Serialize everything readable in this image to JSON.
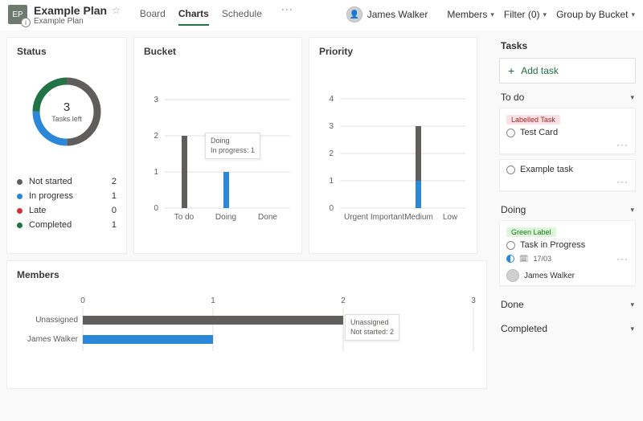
{
  "header": {
    "ep": "EP",
    "title": "Example Plan",
    "subtitle": "Example Plan",
    "star": "☆",
    "tabs": {
      "board": "Board",
      "charts": "Charts",
      "schedule": "Schedule",
      "more": "···"
    },
    "user": "James Walker",
    "actions": {
      "members": "Members",
      "filter": "Filter (0)",
      "group": "Group by Bucket"
    }
  },
  "cards": {
    "status": {
      "title": "Status",
      "center_value": "3",
      "center_label": "Tasks left",
      "legend": [
        {
          "label": "Not started",
          "value": "2",
          "color": "#605e5c"
        },
        {
          "label": "In progress",
          "value": "1",
          "color": "#2b88d8"
        },
        {
          "label": "Late",
          "value": "0",
          "color": "#d13438"
        },
        {
          "label": "Completed",
          "value": "1",
          "color": "#217346"
        }
      ]
    },
    "bucket": {
      "title": "Bucket",
      "tooltip_line1": "Doing",
      "tooltip_line2": "In progress: 1"
    },
    "priority": {
      "title": "Priority"
    },
    "members": {
      "title": "Members",
      "tooltip_line1": "Unassigned",
      "tooltip_line2": "Not started: 2"
    }
  },
  "tasks_panel": {
    "title": "Tasks",
    "add": "Add task",
    "sections": {
      "todo": "To do",
      "doing": "Doing",
      "done": "Done",
      "completed": "Completed"
    },
    "task1_label": "Labelled Task",
    "task1_name": "Test Card",
    "task2_name": "Example task",
    "task3_label": "Green Label",
    "task3_name": "Task in Progress",
    "task3_date": "17/03",
    "task3_assignee": "James Walker"
  },
  "chart_data": [
    {
      "type": "pie",
      "title": "Status",
      "series": [
        {
          "name": "Not started",
          "value": 2,
          "color": "#605e5c"
        },
        {
          "name": "In progress",
          "value": 1,
          "color": "#2b88d8"
        },
        {
          "name": "Late",
          "value": 0,
          "color": "#d13438"
        },
        {
          "name": "Completed",
          "value": 1,
          "color": "#217346"
        }
      ],
      "center_annotation": {
        "value": 3,
        "label": "Tasks left"
      }
    },
    {
      "type": "bar",
      "title": "Bucket",
      "categories": [
        "To do",
        "Doing",
        "Done"
      ],
      "series": [
        {
          "name": "Not started",
          "color": "#605e5c",
          "values": [
            2,
            0,
            0
          ]
        },
        {
          "name": "In progress",
          "color": "#2b88d8",
          "values": [
            0,
            1,
            0
          ]
        },
        {
          "name": "Completed",
          "color": "#217346",
          "values": [
            0,
            0,
            0
          ]
        }
      ],
      "ylim": [
        0,
        3
      ],
      "y_ticks": [
        0,
        1,
        2,
        3
      ]
    },
    {
      "type": "bar",
      "title": "Priority",
      "categories": [
        "Urgent",
        "Important",
        "Medium",
        "Low"
      ],
      "series": [
        {
          "name": "Not started",
          "color": "#605e5c",
          "values": [
            0,
            0,
            2,
            0
          ]
        },
        {
          "name": "In progress",
          "color": "#2b88d8",
          "values": [
            0,
            0,
            1,
            0
          ]
        }
      ],
      "ylim": [
        0,
        4
      ],
      "y_ticks": [
        0,
        1,
        2,
        3,
        4
      ]
    },
    {
      "type": "bar",
      "orientation": "horizontal",
      "title": "Members",
      "categories": [
        "Unassigned",
        "James Walker"
      ],
      "series": [
        {
          "name": "Not started",
          "color": "#605e5c",
          "values": [
            2,
            0
          ]
        },
        {
          "name": "In progress",
          "color": "#2b88d8",
          "values": [
            0,
            1
          ]
        }
      ],
      "xlim": [
        0,
        3
      ],
      "x_ticks": [
        0,
        1,
        2,
        3
      ]
    }
  ]
}
